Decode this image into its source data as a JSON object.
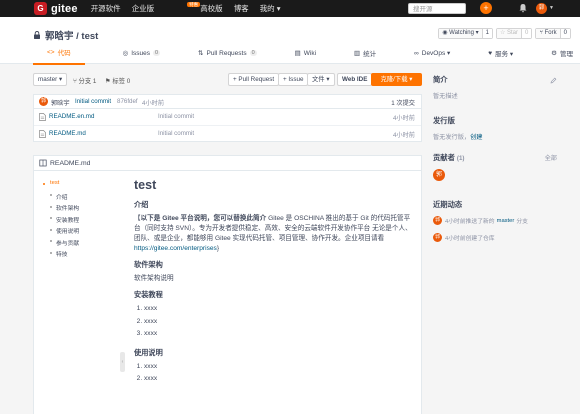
{
  "topbar": {
    "logo_letter": "G",
    "logo_text": "gitee",
    "nav": [
      "开源软件",
      "企业版",
      "高校版",
      "博客",
      "我的 ▾"
    ],
    "enterprise_badge": "特惠",
    "search_placeholder": "搜开源",
    "plus_label": "+",
    "avatar_text": "郭"
  },
  "repo": {
    "title": "郭晗宇 / test",
    "watching_label": "◉ Watching ▾",
    "watching_count": "1",
    "star_label": "☆ Star",
    "star_count": "0",
    "fork_label": "⑂ Fork",
    "fork_count": "0"
  },
  "tabs": [
    {
      "icon": "<>",
      "label": "代码",
      "count": ""
    },
    {
      "icon": "◎",
      "label": "Issues",
      "count": "0"
    },
    {
      "icon": "⇅",
      "label": "Pull Requests",
      "count": "0"
    },
    {
      "icon": "▤",
      "label": "Wiki",
      "count": ""
    },
    {
      "icon": "▥",
      "label": "统计",
      "count": ""
    },
    {
      "icon": "∞",
      "label": "DevOps ▾",
      "count": ""
    },
    {
      "icon": "♥",
      "label": "服务 ▾",
      "count": ""
    },
    {
      "icon": "⚙",
      "label": "管理",
      "count": ""
    }
  ],
  "toolbar": {
    "branch": "master ▾",
    "branches": "⑂ 分支 1",
    "tags": "⚑ 标签 0",
    "pull_request": "+ Pull Request",
    "issue": "+ Issue",
    "file": "文件 ▾",
    "webide": "Web IDE",
    "clone": "克隆/下载 ▾"
  },
  "commit": {
    "avatar": "郭",
    "author": "郭晗宇",
    "message": "Initial commit",
    "hash": "876fdef",
    "time": "4小时前",
    "count": "1 次提交"
  },
  "files": [
    {
      "name": "README.en.md",
      "commit": "Initial commit",
      "time": "4小时前"
    },
    {
      "name": "README.md",
      "commit": "Initial commit",
      "time": "4小时前"
    }
  ],
  "readme": {
    "file_label": "README.md",
    "toc": [
      {
        "label": "test",
        "level": 1
      },
      {
        "label": "介绍",
        "level": 2
      },
      {
        "label": "软件架构",
        "level": 2
      },
      {
        "label": "安装教程",
        "level": 2
      },
      {
        "label": "使用说明",
        "level": 2
      },
      {
        "label": "参与贡献",
        "level": 2
      },
      {
        "label": "特技",
        "level": 2
      }
    ],
    "toc_handle": "‹",
    "h1": "test",
    "intro_heading": "介绍",
    "intro_bold": "以下是 Gitee 平台说明，您可以替换此简介",
    "intro_text": " Gitee 是 OSCHINA 推出的基于 Git 的代码托管平台（同时支持 SVN）。专为开发者提供稳定、高效、安全的云端软件开发协作平台 无论是个人、团队、或是企业，都能够用 Gitee 实现代码托管、项目管理、协作开发。企业项目请看 ",
    "intro_link": "https://gitee.com/enterprises",
    "intro_after": "}",
    "arch_heading": "软件架构",
    "arch_text": "软件架构说明",
    "install_heading": "安装教程",
    "install_items": [
      "xxxx",
      "xxxx",
      "xxxx"
    ],
    "usage_heading": "使用说明",
    "usage_items": [
      "xxxx",
      "xxxx"
    ]
  },
  "sidebar": {
    "intro_heading": "简介",
    "intro_text": "暂无描述",
    "release_heading": "发行版",
    "release_text": "暂无发行版，",
    "release_link": "创建",
    "contrib_heading": "贡献者",
    "contrib_count": "(1)",
    "contrib_all": "全部",
    "contrib_avatar": "郭",
    "activity_heading": "近期动态",
    "activities": [
      {
        "avatar": "郭",
        "pre": "4小时前推送了新的",
        "link": "master",
        "post": "分支"
      },
      {
        "avatar": "郭",
        "pre": "4小时前创建了仓库",
        "link": "",
        "post": ""
      }
    ]
  },
  "colors": {
    "accent": "#fe7300",
    "brand": "#c71d23",
    "link": "#005980"
  }
}
